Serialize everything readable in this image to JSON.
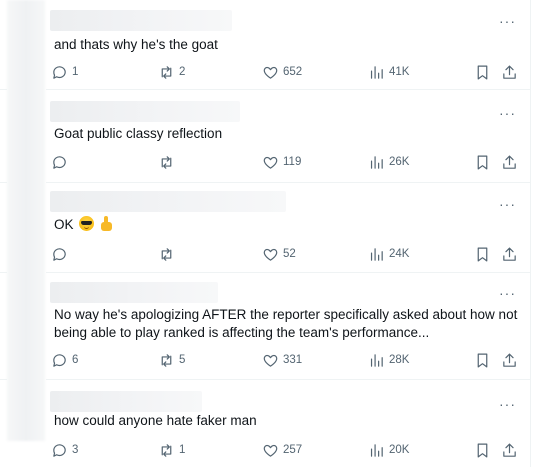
{
  "tweets": [
    {
      "text": "and thats why he's the goat",
      "replies": "1",
      "retweets": "2",
      "likes": "652",
      "views": "41K"
    },
    {
      "text": "Goat public classy reflection",
      "replies": "",
      "retweets": "",
      "likes": "119",
      "views": "26K"
    },
    {
      "text": "OK",
      "emojis": [
        "smiling-face-with-sunglasses",
        "thumbs-up"
      ],
      "replies": "",
      "retweets": "",
      "likes": "52",
      "views": "24K"
    },
    {
      "text": "No way he's apologizing AFTER the reporter specifically asked about how not being able to play ranked is affecting the team's performance...",
      "replies": "6",
      "retweets": "5",
      "likes": "331",
      "views": "28K"
    },
    {
      "text": "how could anyone hate faker man",
      "replies": "3",
      "retweets": "1",
      "likes": "257",
      "views": "20K"
    }
  ],
  "more_label": "···",
  "colors": {
    "text": "#0f1419",
    "muted": "#536471",
    "divider": "#eff3f4"
  },
  "icons": {
    "reply": "reply-icon",
    "retweet": "retweet-icon",
    "like": "heart-icon",
    "views": "views-icon",
    "bookmark": "bookmark-icon",
    "share": "share-icon"
  }
}
